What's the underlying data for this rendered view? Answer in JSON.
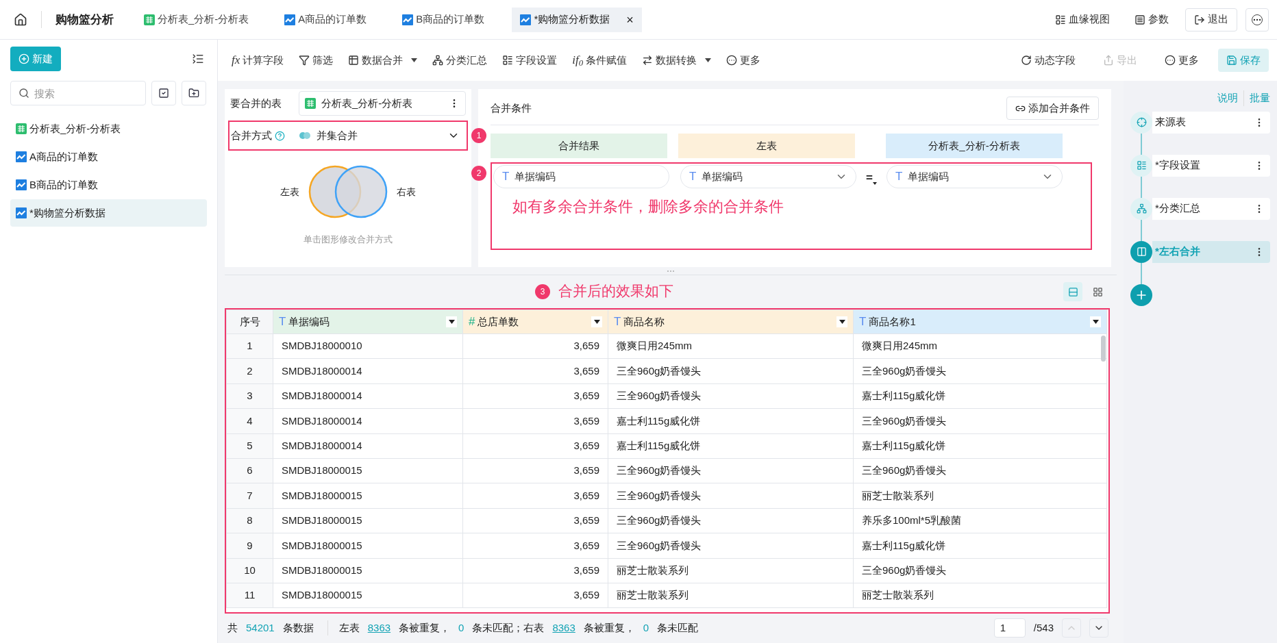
{
  "app": {
    "title": "购物篮分析"
  },
  "tabs": [
    {
      "label": "分析表_分析-分析表",
      "kind": "table",
      "selected": false
    },
    {
      "label": "A商品的订单数",
      "kind": "analysis",
      "selected": false
    },
    {
      "label": "B商品的订单数",
      "kind": "analysis",
      "selected": false
    },
    {
      "label": "*购物篮分析数据",
      "kind": "analysis",
      "selected": true,
      "close": "×"
    }
  ],
  "top_actions": [
    {
      "label": "血缘视图"
    },
    {
      "label": "参数"
    },
    {
      "label": "退出"
    }
  ],
  "sidebar": {
    "new_button": "新建",
    "search_placeholder": "搜索",
    "items": [
      {
        "label": "分析表_分析-分析表",
        "kind": "table",
        "selected": false
      },
      {
        "label": "A商品的订单数",
        "kind": "analysis",
        "selected": false
      },
      {
        "label": "B商品的订单数",
        "kind": "analysis",
        "selected": false
      },
      {
        "label": "*购物篮分析数据",
        "kind": "analysis",
        "selected": true
      }
    ]
  },
  "toolbar": {
    "left": [
      {
        "label": "计算字段",
        "icon_text": "fx",
        "dropdown": false
      },
      {
        "label": "筛选",
        "dropdown": false
      },
      {
        "label": "数据合并",
        "dropdown": true
      },
      {
        "label": "分类汇总",
        "dropdown": false
      },
      {
        "label": "字段设置",
        "dropdown": false
      },
      {
        "label": "条件赋值",
        "icon_text": "if$_{0}$",
        "dropdown": false
      },
      {
        "label": "数据转换",
        "dropdown": true
      },
      {
        "label": "更多",
        "dropdown": false
      }
    ],
    "right": [
      {
        "label": "动态字段",
        "disabled": false,
        "highlighted": false
      },
      {
        "label": "导出",
        "disabled": true,
        "highlighted": false
      },
      {
        "label": "更多",
        "disabled": false,
        "highlighted": false
      },
      {
        "label": "保存",
        "disabled": false,
        "highlighted": true
      }
    ]
  },
  "merge_setup": {
    "target_label": "要合并的表",
    "target_value": "分析表_分析-分析表",
    "mode_label": "合并方式",
    "mode_value": "并集合并",
    "venn_left": "左表",
    "venn_right": "右表",
    "hint": "单击图形修改合并方式"
  },
  "conditions": {
    "title": "合并条件",
    "add_button": "添加合并条件",
    "headers": [
      {
        "label": "合并结果",
        "color": "#e3f3e8"
      },
      {
        "label": "左表",
        "color": "#fdf0da"
      },
      {
        "label": "分析表_分析-分析表",
        "color": "#d9edfb"
      }
    ],
    "rows": [
      {
        "result_type": "T",
        "result": "单据编码",
        "left_type": "T",
        "left": "单据编码",
        "operator": "=",
        "right_type": "T",
        "right": "单据编码"
      }
    ]
  },
  "annotations": [
    {
      "number": "1"
    },
    {
      "number": "2",
      "text": "如有多余合并条件，删除多余的合并条件"
    },
    {
      "number": "3",
      "text": "合并后的效果如下"
    }
  ],
  "steps_panel": {
    "links": [
      "说明",
      "批量"
    ],
    "steps": [
      {
        "label": "来源表",
        "selected": false
      },
      {
        "label": "*字段设置",
        "selected": false
      },
      {
        "label": "*分类汇总",
        "selected": false
      },
      {
        "label": "*左右合并",
        "selected": true
      }
    ]
  },
  "view_toggle": [
    {
      "selected": true
    },
    {
      "selected": false
    }
  ],
  "table": {
    "columns": [
      {
        "label": "序号",
        "kind": "index"
      },
      {
        "label": "单据编码",
        "kind": "text",
        "type_symbol": "T",
        "color": "#e3f3e8"
      },
      {
        "label": "总店单数",
        "kind": "number",
        "type_symbol": "#",
        "color": "#fdf0da"
      },
      {
        "label": "商品名称",
        "kind": "text",
        "type_symbol": "T",
        "color": "#fdf0da"
      },
      {
        "label": "商品名称1",
        "kind": "text",
        "type_symbol": "T",
        "color": "#d9edfb"
      }
    ],
    "rows": [
      [
        "1",
        "SMDBJ18000010",
        "3,659",
        "微爽日用245mm",
        "微爽日用245mm"
      ],
      [
        "2",
        "SMDBJ18000014",
        "3,659",
        "三全960g奶香馒头",
        "三全960g奶香馒头"
      ],
      [
        "3",
        "SMDBJ18000014",
        "3,659",
        "三全960g奶香馒头",
        "嘉士利115g威化饼"
      ],
      [
        "4",
        "SMDBJ18000014",
        "3,659",
        "嘉士利115g威化饼",
        "三全960g奶香馒头"
      ],
      [
        "5",
        "SMDBJ18000014",
        "3,659",
        "嘉士利115g威化饼",
        "嘉士利115g威化饼"
      ],
      [
        "6",
        "SMDBJ18000015",
        "3,659",
        "三全960g奶香馒头",
        "三全960g奶香馒头"
      ],
      [
        "7",
        "SMDBJ18000015",
        "3,659",
        "三全960g奶香馒头",
        "丽芝士散装系列"
      ],
      [
        "8",
        "SMDBJ18000015",
        "3,659",
        "三全960g奶香馒头",
        "养乐多100ml*5乳酸菌"
      ],
      [
        "9",
        "SMDBJ18000015",
        "3,659",
        "三全960g奶香馒头",
        "嘉士利115g威化饼"
      ],
      [
        "10",
        "SMDBJ18000015",
        "3,659",
        "丽芝士散装系列",
        "三全960g奶香馒头"
      ],
      [
        "11",
        "SMDBJ18000015",
        "3,659",
        "丽芝士散装系列",
        "丽芝士散装系列"
      ]
    ]
  },
  "footer": {
    "segments": [
      {
        "kind": "text",
        "text": "共"
      },
      {
        "kind": "count",
        "text": "54201"
      },
      {
        "kind": "text",
        "text": "条数据"
      },
      {
        "kind": "text",
        "text": "左表"
      },
      {
        "kind": "link",
        "text": "8363"
      },
      {
        "kind": "text",
        "text": "条被重复，"
      },
      {
        "kind": "count",
        "text": "0"
      },
      {
        "kind": "text",
        "text": "条未匹配；右表"
      },
      {
        "kind": "link",
        "text": "8363"
      },
      {
        "kind": "text",
        "text": "条被重复，"
      },
      {
        "kind": "count",
        "text": "0"
      },
      {
        "kind": "text",
        "text": "条未匹配"
      }
    ],
    "page": "1",
    "total": "/543"
  }
}
